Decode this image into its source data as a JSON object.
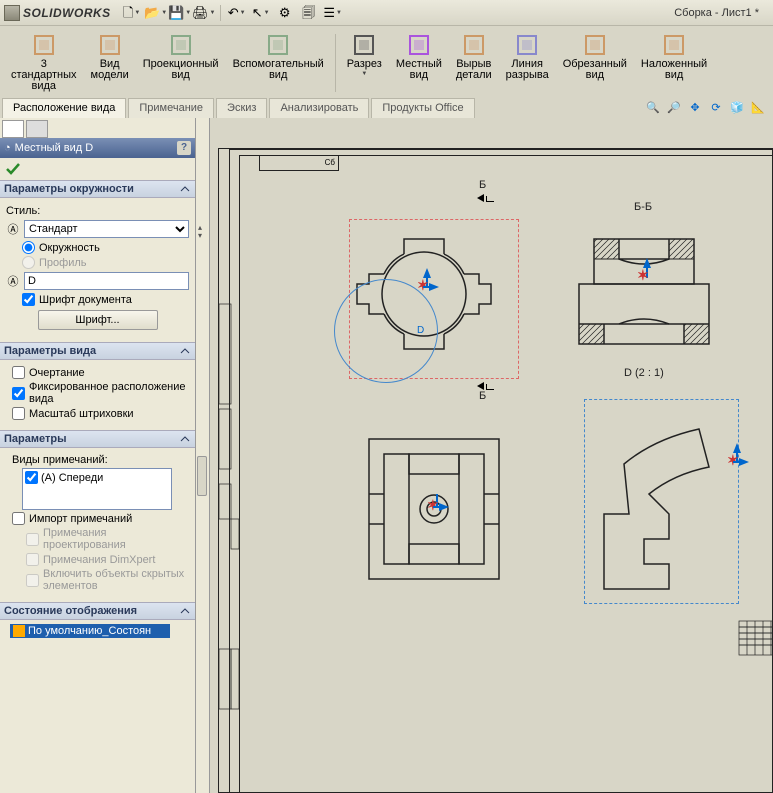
{
  "app": {
    "name": "SOLIDWORKS",
    "doc_title": "Сборка - Лист1 *"
  },
  "qat": {
    "new": "🗋",
    "open": "📂",
    "save": "💾",
    "print": "🖨",
    "undo": "↶",
    "select": "↖",
    "rebuild": "⚙",
    "options": "🗐",
    "list": "☰"
  },
  "ribbon": [
    {
      "label": "3\nстандартных\nвида"
    },
    {
      "label": "Вид\nмодели"
    },
    {
      "label": "Проекционный\nвид"
    },
    {
      "label": "Вспомогательный\nвид"
    },
    {
      "label": "Разрез",
      "drop": true
    },
    {
      "label": "Местный\nвид"
    },
    {
      "label": "Вырыв\nдетали"
    },
    {
      "label": "Линия\nразрыва"
    },
    {
      "label": "Обрезанный\nвид"
    },
    {
      "label": "Наложенный\nвид"
    }
  ],
  "tabs": [
    "Расположение вида",
    "Примечание",
    "Эскиз",
    "Анализировать",
    "Продукты Office"
  ],
  "pm": {
    "title": "Местный вид D",
    "sec_circle": "Параметры окружности",
    "style_label": "Стиль:",
    "style_value": "Стандарт",
    "opt_circle": "Окружность",
    "opt_profile": "Профиль",
    "name_value": "D",
    "doc_font": "Шрифт документа",
    "font_btn": "Шрифт...",
    "sec_view": "Параметры вида",
    "outline": "Очертание",
    "fixed_pos": "Фиксированное расположение вида",
    "hatch_scale": "Масштаб штриховки",
    "sec_params": "Параметры",
    "note_types": "Виды примечаний:",
    "front": "(А) Спереди",
    "import_notes": "Импорт примечаний",
    "proj_notes": "Примечания проектирования",
    "dimxpert": "Примечания DimXpert",
    "hidden_obj": "Включить объекты скрытых элементов",
    "sec_state": "Состояние отображения",
    "state_item": "По умолчанию_Состоян"
  },
  "canvas": {
    "topbox": "Сб",
    "section_letter": "Б",
    "bb_label": "Б-Б",
    "detail_label": "D  (2 : 1)",
    "detail_circle_label": "D"
  }
}
